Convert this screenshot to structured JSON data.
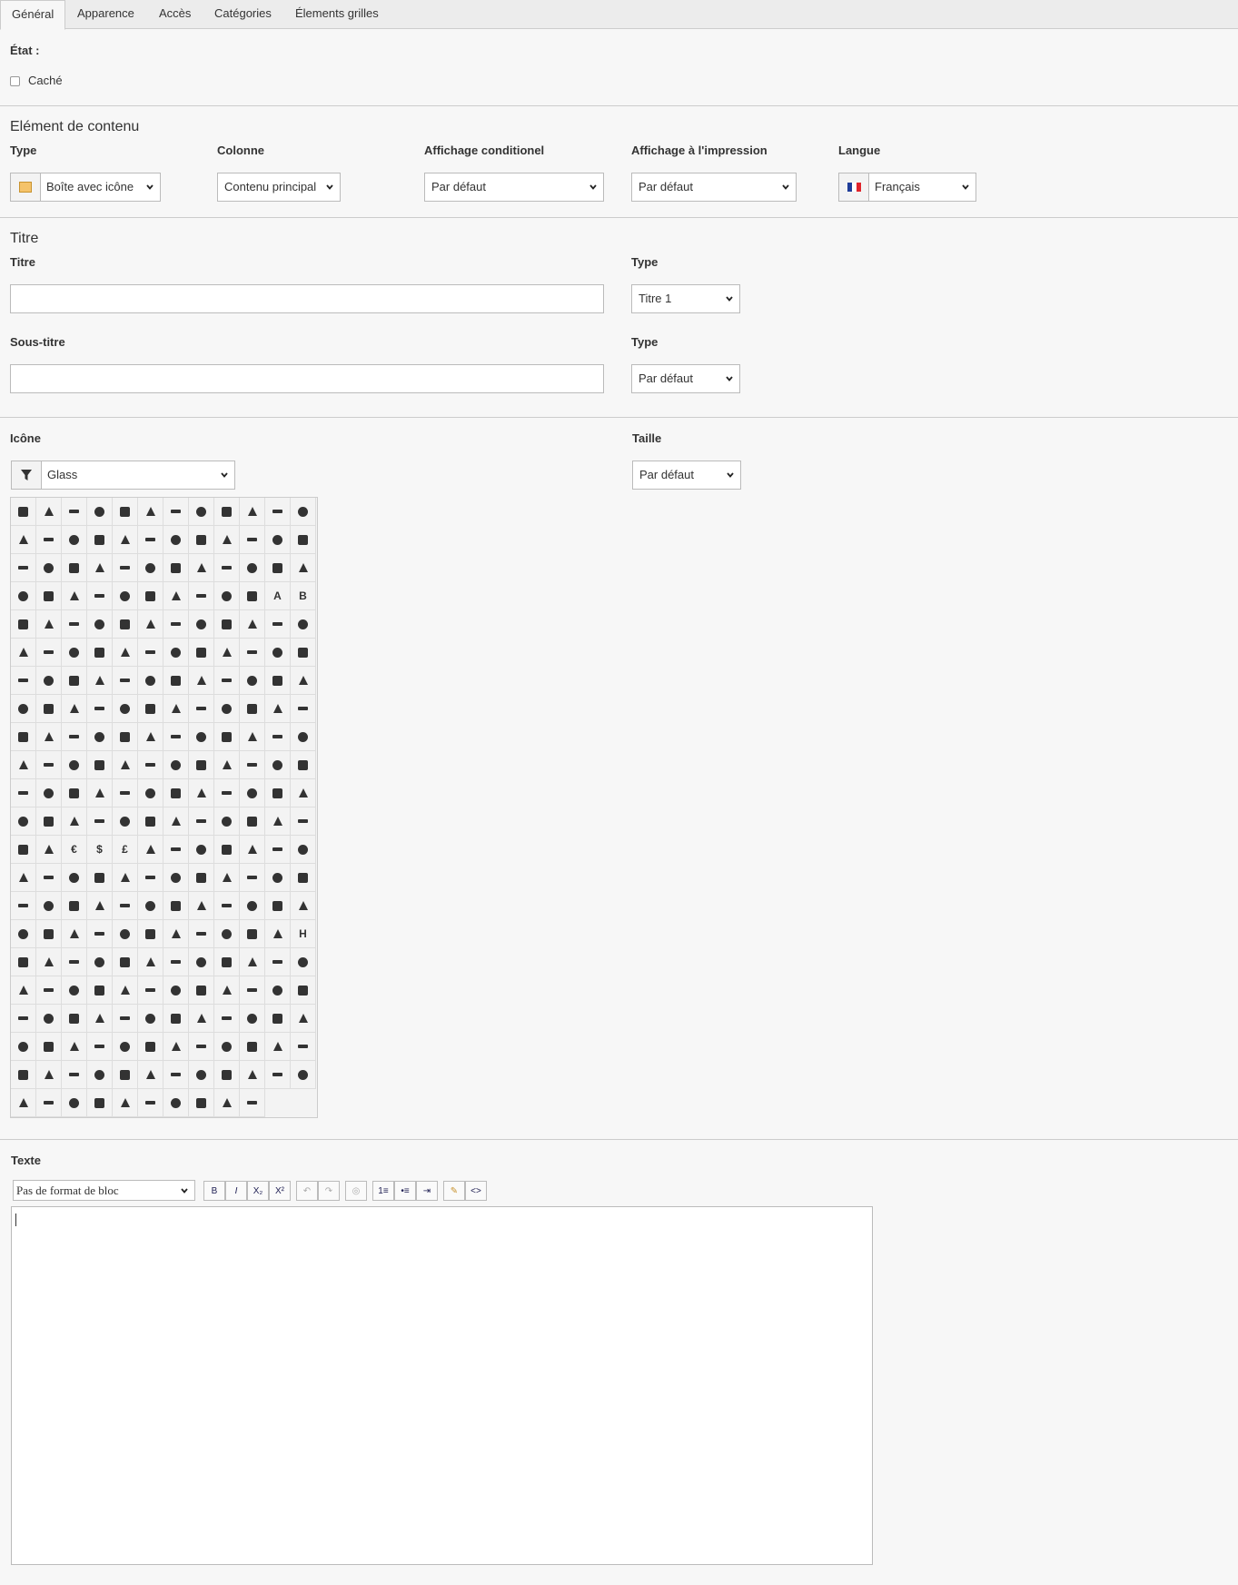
{
  "tabs": [
    "Général",
    "Apparence",
    "Accès",
    "Catégories",
    "Élements grilles"
  ],
  "state": {
    "label": "État :",
    "hidden_label": "Caché",
    "hidden_checked": false
  },
  "content_element": {
    "section_title": "Elément de contenu",
    "type": {
      "label": "Type",
      "value": "Boîte avec icône",
      "icon": "box-icon"
    },
    "column": {
      "label": "Colonne",
      "value": "Contenu principal"
    },
    "conditional_display": {
      "label": "Affichage conditionel",
      "value": "Par défaut"
    },
    "print_display": {
      "label": "Affichage à l'impression",
      "value": "Par défaut"
    },
    "language": {
      "label": "Langue",
      "value": "Français",
      "icon": "flag-fr-icon"
    }
  },
  "title_section": {
    "section_title": "Titre",
    "title_label": "Titre",
    "title_value": "",
    "title_type_label": "Type",
    "title_type_value": "Titre 1",
    "subtitle_label": "Sous-titre",
    "subtitle_value": "",
    "subtitle_type_label": "Type",
    "subtitle_type_value": "Par défaut"
  },
  "icon_section": {
    "label": "Icône",
    "filter_icon": "filter-icon",
    "selected": "Glass",
    "size_label": "Taille",
    "size_value": "Par défaut",
    "grid_columns": 12,
    "grid_rows": 22,
    "last_row_count": 10,
    "text_glyphs": {
      "3-10": "A",
      "3-11": "B",
      "11-11": "",
      "12-3": "$",
      "12-4": "£",
      "12-2": "€",
      "15-11": "H"
    }
  },
  "text_section": {
    "label": "Texte",
    "block_format": "Pas de format de bloc",
    "buttons": [
      {
        "name": "bold-button",
        "label": "B"
      },
      {
        "name": "italic-button",
        "label": "I"
      },
      {
        "name": "subscript-button",
        "label": "X₂"
      },
      {
        "name": "superscript-button",
        "label": "X²"
      },
      {
        "name": "undo-button",
        "label": "↶"
      },
      {
        "name": "redo-button",
        "label": "↷"
      },
      {
        "name": "link-button",
        "label": "◎"
      },
      {
        "name": "ordered-list-button",
        "label": "1≡"
      },
      {
        "name": "unordered-list-button",
        "label": "•≡"
      },
      {
        "name": "indent-button",
        "label": "⇥"
      },
      {
        "name": "clean-button",
        "label": "✎"
      },
      {
        "name": "source-code-button",
        "label": "<>"
      }
    ],
    "editor_value": ""
  },
  "colors": {
    "border": "#cccccc",
    "background": "#f7f7f7",
    "text": "#333333"
  }
}
